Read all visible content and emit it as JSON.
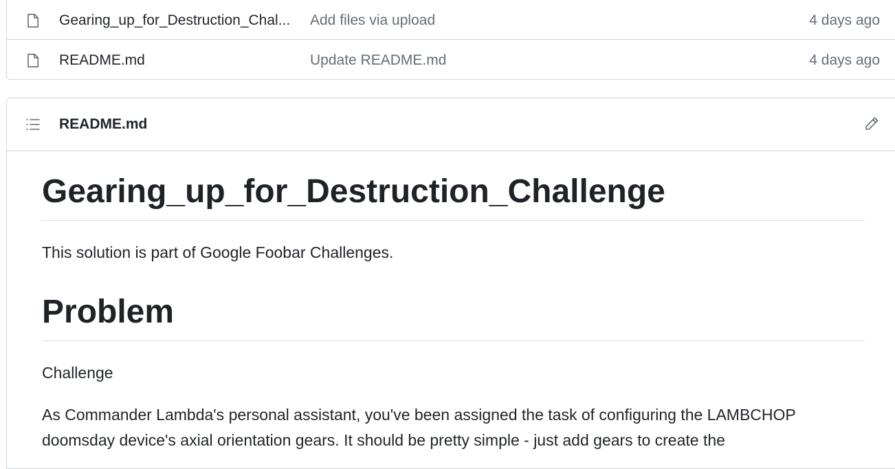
{
  "files": [
    {
      "icon": "file-icon",
      "name": "Gearing_up_for_Destruction_Chal...",
      "commit_message": "Add files via upload",
      "age": "4 days ago"
    },
    {
      "icon": "file-icon",
      "name": "README.md",
      "commit_message": "Update README.md",
      "age": "4 days ago"
    }
  ],
  "readme": {
    "header_title": "README.md",
    "toc_icon": "list-unordered-icon",
    "edit_icon": "pencil-icon",
    "heading": "Gearing_up_for_Destruction_Challenge",
    "intro": "This solution is part of Google Foobar Challenges.",
    "problem_heading": "Problem",
    "challenge_label": "Challenge",
    "description_line1": "As Commander Lambda's personal assistant, you've been assigned the task of configuring the LAMBCHOP",
    "description_line2": "doomsday device's axial orientation gears. It should be pretty simple - just add gears to create the"
  },
  "colors": {
    "text": "#1f2328",
    "muted": "#656d76",
    "border": "#d0d7de"
  }
}
